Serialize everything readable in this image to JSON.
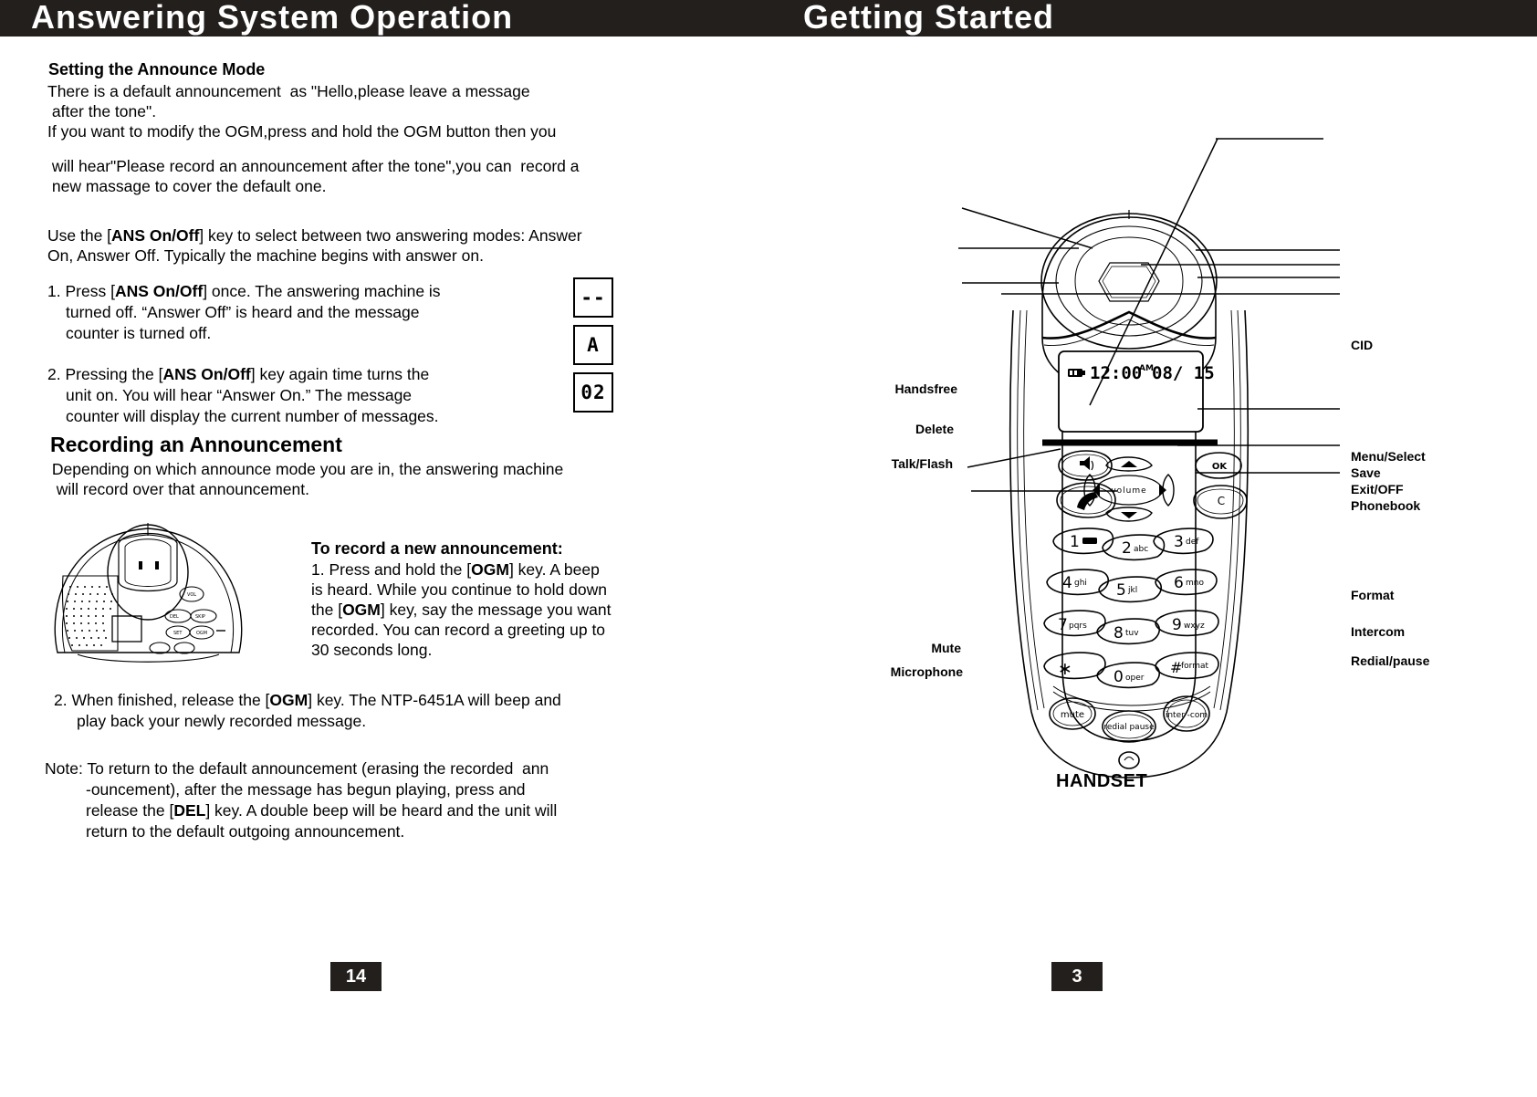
{
  "header": {
    "left_title": "Answering System Operation",
    "right_title": "Getting Started",
    "bar_color": "#231f1c"
  },
  "left_page": {
    "page_number": "14",
    "announce_mode": {
      "heading": "Setting the Announce Mode",
      "line1": "There is a default announcement  as \"Hello,please leave a message",
      "line2": " after the tone\".",
      "line3": "If you want to modify the OGM,press and hold the OGM button then you",
      "line4": " will hear\"Please record an announcement after the tone\",you can  record a",
      "line5": " new massage to cover the default one."
    },
    "ans_intro": {
      "line1_a": "Use the [",
      "line1_key": "ANS On/Off",
      "line1_b": "] key to select between two answering modes: Answer",
      "line2": "On, Answer Off. Typically the machine begins with answer on."
    },
    "steps": [
      {
        "num": "1.",
        "a": " Press [",
        "key": "ANS On/Off",
        "b": "] once. The answering machine is",
        "line2": "turned off. “Answer Off” is heard and the message",
        "line3": "counter is turned off."
      },
      {
        "num": "2.",
        "a": " Pressing the [",
        "key": "ANS On/Off",
        "b": "] key again time turns the",
        "line2": "unit on. You will hear “Answer On.” The message",
        "line3": "counter will display the current number of messages."
      }
    ],
    "lcd_counters": [
      {
        "value": "--"
      },
      {
        "value": "A"
      },
      {
        "value": "02"
      }
    ],
    "recording": {
      "heading": "Recording an Announcement",
      "line1": " Depending on which announce mode you are in, the answering machine",
      "line2": "  will record over that announcement."
    },
    "record_new": {
      "heading": "To record a new announcement:",
      "l1_a": "1. Press and hold the [",
      "l1_key": "OGM",
      "l1_b": "] key. A beep",
      "l2": "is heard. While you continue to hold down",
      "l3_a": "the [",
      "l3_key": "OGM",
      "l3_b": "] key, say the message you want",
      "l4": "recorded. You can record a greeting up to",
      "l5": "30 seconds long."
    },
    "step2": {
      "num": "2.",
      "a": " When finished, release the [",
      "key": "OGM",
      "b": "] key. The NTP-6451A will beep and",
      "line2": "play back your newly recorded message."
    },
    "note": {
      "label": "Note:",
      "l1": " To return to the default announcement (erasing the recorded  ann",
      "l2": "-ouncement), after the message has begun playing, press and",
      "l3_a": "release the [",
      "l3_key": "DEL",
      "l3_b": "] key. A double beep will be heard and the unit will",
      "l4": "return to the default outgoing announcement."
    }
  },
  "right_page": {
    "page_number": "3",
    "caption": "HANDSET",
    "lcd": {
      "battery_icon": "battery-icon",
      "time": "12:00",
      "meridiem": "AM",
      "date": "08/ 15"
    },
    "labels_left": [
      {
        "text": "Handsfree"
      },
      {
        "text": "Delete"
      },
      {
        "text": "Talk/Flash"
      },
      {
        "text": "Mute"
      },
      {
        "text": "Microphone"
      }
    ],
    "labels_right": [
      {
        "text": "CID"
      },
      {
        "text": "Menu/Select"
      },
      {
        "text": "Save"
      },
      {
        "text": "Exit/OFF"
      },
      {
        "text": "Phonebook"
      },
      {
        "text": "Format"
      },
      {
        "text": "Intercom"
      },
      {
        "text": "Redial/pause"
      }
    ],
    "keypad": [
      {
        "digit": "1",
        "letters": ""
      },
      {
        "digit": "2",
        "letters": "abc"
      },
      {
        "digit": "3",
        "letters": "def"
      },
      {
        "digit": "4",
        "letters": "ghi"
      },
      {
        "digit": "5",
        "letters": "jkl"
      },
      {
        "digit": "6",
        "letters": "mno"
      },
      {
        "digit": "7",
        "letters": "pqrs"
      },
      {
        "digit": "8",
        "letters": "tuv"
      },
      {
        "digit": "9",
        "letters": "wxyz"
      },
      {
        "digit": "∗",
        "letters": ""
      },
      {
        "digit": "0",
        "letters": "oper"
      },
      {
        "digit": "#",
        "letters": "format"
      }
    ],
    "function_keys": [
      {
        "label": "OK"
      },
      {
        "label": "C"
      },
      {
        "label": "volume"
      },
      {
        "label": "mute"
      },
      {
        "label": "redial pause"
      },
      {
        "label": "inter -com"
      }
    ]
  }
}
